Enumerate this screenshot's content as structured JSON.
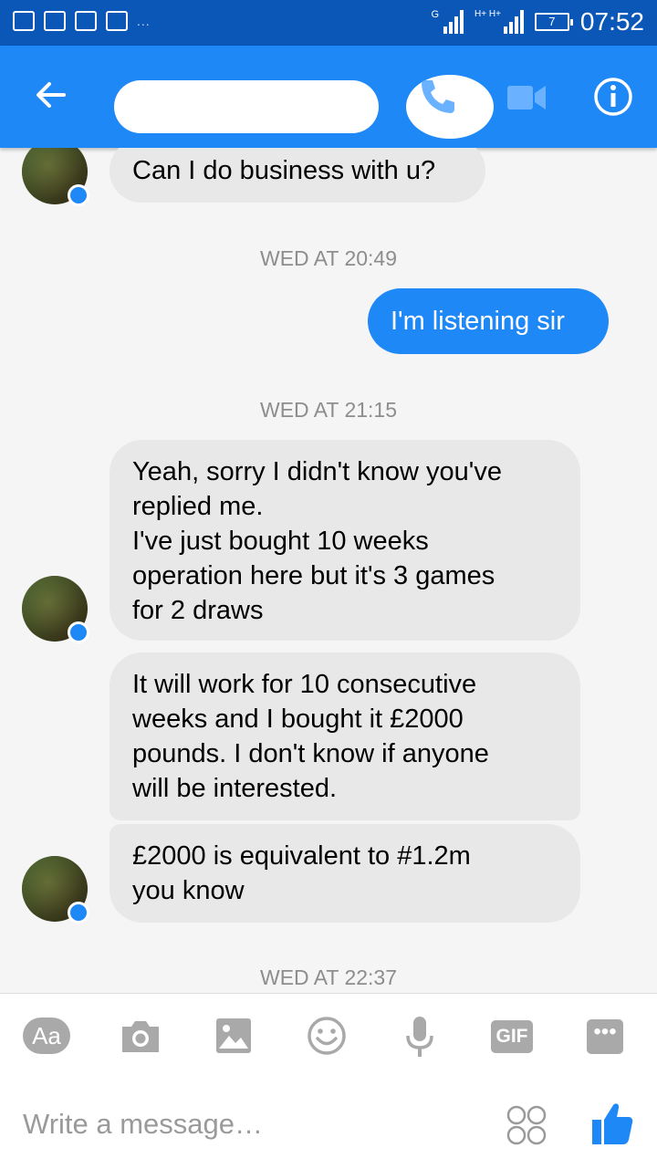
{
  "status_bar": {
    "time": "07:52",
    "battery": "7",
    "network_1": "G",
    "network_2": "H+ H+",
    "overflow": "..."
  },
  "header": {
    "contact_name_redacted": "",
    "icons": [
      "back-arrow-icon",
      "phone-icon",
      "video-camera-icon",
      "info-icon"
    ],
    "accent": "#1e88f7"
  },
  "messages": {
    "m1": "Can I do business with u?",
    "ts1": "WED AT 20:49",
    "m2": "I'm listening sir",
    "ts2": "WED AT 21:15",
    "m3_l1": "Yeah, sorry I didn't know you've",
    "m3_l2": "replied me.",
    "m3_l3": "I've just bought 10 weeks",
    "m3_l4": "operation here but it's 3 games",
    "m3_l5": "for 2 draws",
    "m4_l1": "It will work for 10 consecutive",
    "m4_l2": "weeks and I bought it £2000",
    "m4_l3": "pounds. I don't know if anyone",
    "m4_l4": "will be interested.",
    "m5_l1": "£2000 is equivalent to #1.2m",
    "m5_l2": "you know",
    "ts3": "WED AT 22:37"
  },
  "composer": {
    "aa_label": "Aa",
    "gif_label": "GIF",
    "placeholder": "Write a message…",
    "tools": [
      "text-format-icon",
      "camera-icon",
      "image-icon",
      "emoji-icon",
      "microphone-icon",
      "gif-icon",
      "more-icon"
    ]
  }
}
